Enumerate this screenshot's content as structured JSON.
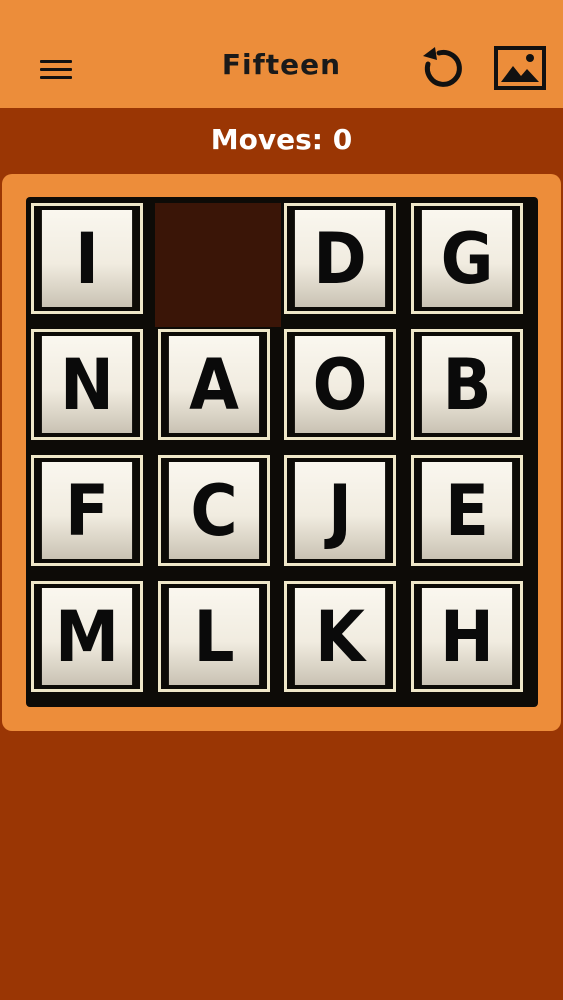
{
  "app": {
    "title": "Fifteen"
  },
  "toolbar": {
    "menu_icon": "hamburger-menu-icon",
    "refresh_icon": "refresh-icon",
    "image_icon": "image-icon"
  },
  "status": {
    "moves_label": "Moves: 0"
  },
  "board": {
    "rows": 4,
    "cols": 4,
    "tiles": [
      [
        "I",
        "",
        "D",
        "G"
      ],
      [
        "N",
        "A",
        "O",
        "B"
      ],
      [
        "F",
        "C",
        "J",
        "E"
      ],
      [
        "M",
        "L",
        "K",
        "H"
      ]
    ]
  },
  "colors": {
    "app_bar": "#ec8d3a",
    "background": "#9a3604",
    "board_panel": "#ed8d3a",
    "empty_slot": "#3a1507",
    "tile_face": "#f1ece0",
    "tile_border": "#efe7c8"
  }
}
